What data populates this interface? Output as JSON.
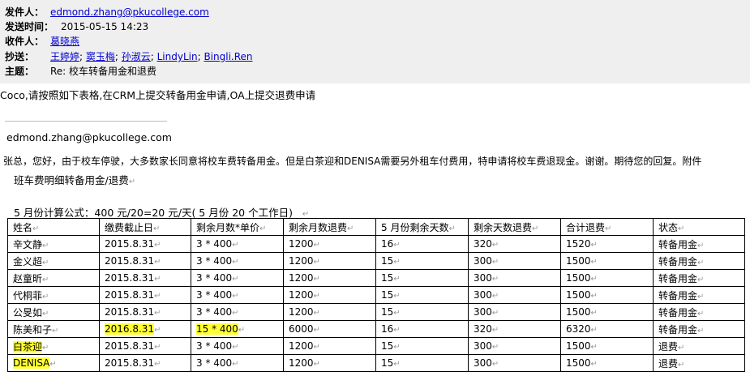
{
  "email": {
    "from_label": "发件人：",
    "from_value": "edmond.zhang@pkucollege.com",
    "sent_label": "发送时间：",
    "sent_value": "2015-05-15 14:23",
    "to_label": "收件人：",
    "to_value": "葛晓燕",
    "cc_label": "抄送：",
    "cc": [
      "王婷婷",
      "窦玉梅",
      "孙淑云",
      "LindyLin",
      "Bingli.Ren"
    ],
    "subject_label": "主题：",
    "subject_value": "Re: 校车转备用金和退费"
  },
  "body": {
    "line1": "Coco,请按照如下表格,在CRM上提交转备用金申请,OA上提交退费申请",
    "quoted_sender": "edmond.zhang@pkucollege.com",
    "line2": "张总，您好，由于校车停驶，大多数家长同意将校车费转备用金。但是白茶迎和DENISA需要另外租车付费用，特申请将校车费退现金。谢谢。期待您的回复。附件",
    "table_title": "班车费明细转备用金/退费",
    "formula": "5 月份计算公式：400 元/20=20 元/天( 5 月份 20 个工作日)",
    "cell_mark": "↵"
  },
  "table": {
    "headers": [
      "姓名",
      "缴费截止日",
      "剩余月数*单价",
      "剩余月数退费",
      "5 月份剩余天数",
      "剩余天数退费",
      "合计退费",
      "状态"
    ],
    "rows": [
      {
        "cells": [
          "辛文静",
          "2015.8.31",
          "3  *  400",
          "1200",
          "16",
          "320",
          "1520",
          "转备用金"
        ],
        "hl": []
      },
      {
        "cells": [
          "金义超",
          "2015.8.31",
          "3  *  400",
          "1200",
          "15",
          "300",
          "1500",
          "转备用金"
        ],
        "hl": []
      },
      {
        "cells": [
          "赵童昕",
          "2015.8.31",
          "3  *  400",
          "1200",
          "15",
          "300",
          "1500",
          "转备用金"
        ],
        "hl": []
      },
      {
        "cells": [
          "代桐菲",
          "2015.8.31",
          "3  *  400",
          "1200",
          "15",
          "300",
          "1500",
          "转备用金"
        ],
        "hl": []
      },
      {
        "cells": [
          "公旻如",
          "2015.8.31",
          "3  *  400",
          "1200",
          "15",
          "300",
          "1500",
          "转备用金"
        ],
        "hl": []
      },
      {
        "cells": [
          "陈美和子",
          "2016.8.31",
          "15 * 400",
          "6000",
          "16",
          "320",
          "6320",
          "转备用金"
        ],
        "hl": [
          1,
          2
        ]
      },
      {
        "cells": [
          "白茶迎",
          "2015.8.31",
          "3  *  400",
          "1200",
          "15",
          "300",
          "1500",
          "退费"
        ],
        "hl": [
          0
        ]
      },
      {
        "cells": [
          "DENISA",
          "2015.8.31",
          "3  *  400",
          "1200",
          "15",
          "300",
          "1500",
          "退费"
        ],
        "hl": [
          0
        ]
      }
    ]
  },
  "colors": {
    "link": "#0000cc",
    "header_bg": "#efefef",
    "highlight": "#ffff33"
  }
}
